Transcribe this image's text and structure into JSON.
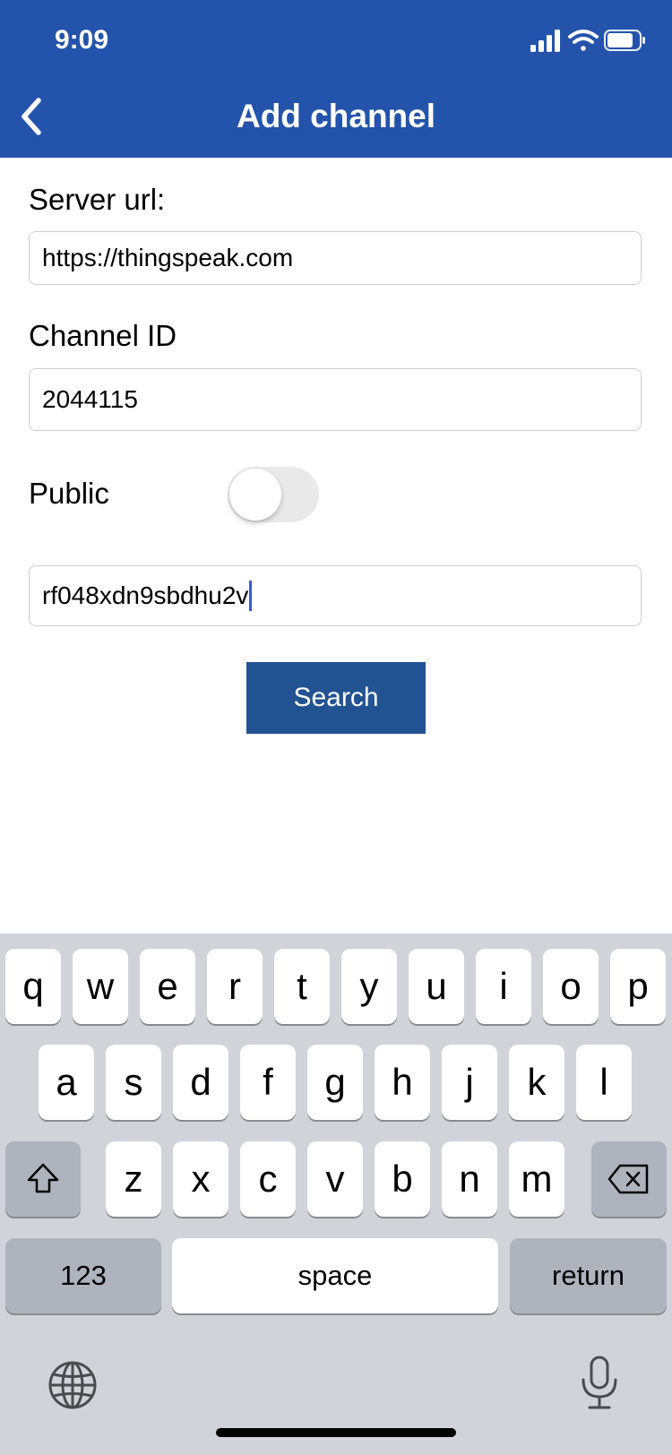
{
  "status_bar": {
    "time": "9:09",
    "icons": [
      "signal-icon",
      "wifi-icon",
      "battery-icon"
    ]
  },
  "nav": {
    "title": "Add channel",
    "back_icon": "chevron-left-icon"
  },
  "form": {
    "server_url_label": "Server url:",
    "server_url_value": "https://thingspeak.com",
    "channel_id_label": "Channel ID",
    "channel_id_value": "2044115",
    "public_label": "Public",
    "public_toggle_on": false,
    "api_key_value": "rf048xdn9sbdhu2v",
    "search_label": "Search"
  },
  "keyboard": {
    "row1": [
      "q",
      "w",
      "e",
      "r",
      "t",
      "y",
      "u",
      "i",
      "o",
      "p"
    ],
    "row2": [
      "a",
      "s",
      "d",
      "f",
      "g",
      "h",
      "j",
      "k",
      "l"
    ],
    "row3": [
      "z",
      "x",
      "c",
      "v",
      "b",
      "n",
      "m"
    ],
    "numbers_label": "123",
    "space_label": "space",
    "return_label": "return",
    "icons": [
      "shift-icon",
      "backspace-icon",
      "globe-icon",
      "microphone-icon"
    ]
  },
  "colors": {
    "header": "#2353ab",
    "button": "#215392",
    "caret": "#3a58e0"
  }
}
